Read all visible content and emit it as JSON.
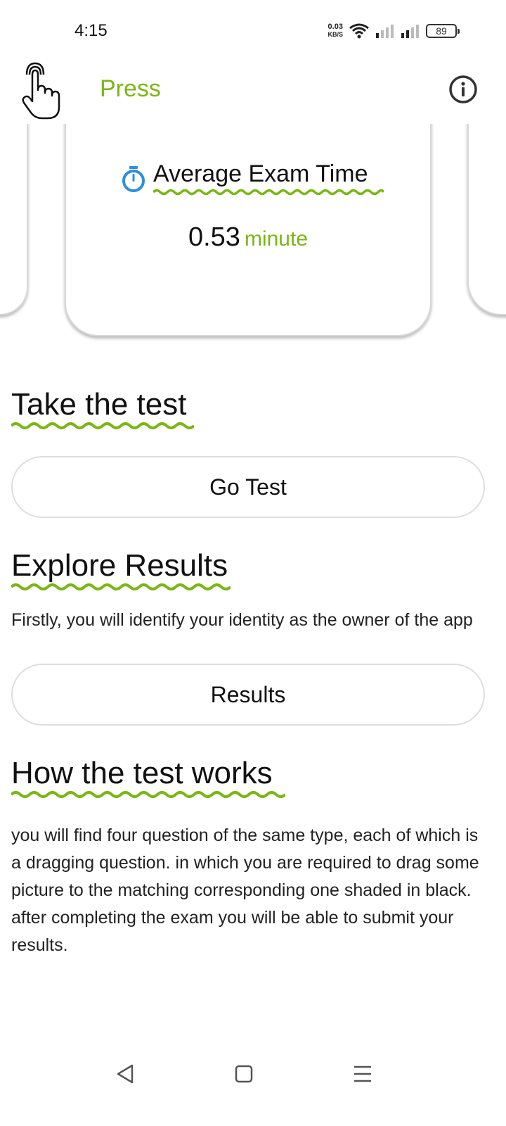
{
  "status_bar": {
    "time": "4:15",
    "net_speed_value": "0.03",
    "net_speed_unit": "KB/S",
    "battery": "89"
  },
  "app_bar": {
    "title": "Press",
    "logo_icon": "finger-press-icon",
    "info_icon": "info-icon"
  },
  "stat_card": {
    "title": "Average Exam Time",
    "value": "0.53",
    "unit": "minute",
    "icon": "stopwatch-icon"
  },
  "take_test": {
    "heading": "Take the test",
    "button_label": "Go Test"
  },
  "explore_results": {
    "heading": "Explore Results",
    "description": "Firstly, you will identify your identity as the owner of the app",
    "button_label": "Results"
  },
  "how_it_works": {
    "heading": "How the test works",
    "description": "you will find four question of the same type, each of which is a dragging question. in which you are required to drag some picture to the matching corresponding one shaded in black. after completing the exam you will be able to submit your results."
  },
  "nav_bar": {
    "back_icon": "back-triangle-icon",
    "home_icon": "home-square-icon",
    "menu_icon": "menu-lines-icon"
  },
  "colors": {
    "accent": "#7cb518",
    "timer_blue": "#2f8fdc",
    "text": "#111111"
  }
}
